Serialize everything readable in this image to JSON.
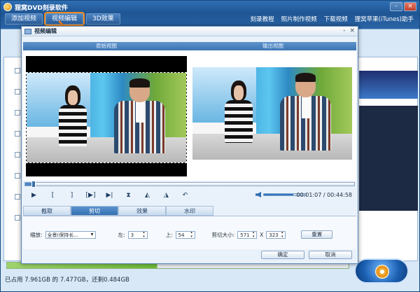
{
  "app": {
    "title": "狸窝DVD刻录软件",
    "window_controls": [
      "-",
      "×"
    ]
  },
  "main_tabs": [
    {
      "label": "添加视频"
    },
    {
      "label": "视频编辑"
    },
    {
      "label": "3D效果"
    }
  ],
  "main_links": [
    "刻录教程",
    "照片制作视频",
    "下载视频",
    "狸窝苹果(iTunes)助手"
  ],
  "status": {
    "disk_info": "已占用 7.961GB 的 7.477GB，还剩0.484GB"
  },
  "dialog": {
    "title": "视频编辑",
    "window_controls": [
      "-",
      "×"
    ],
    "view_headers": {
      "original": "原始视图",
      "output": "输出视图"
    },
    "playback": {
      "controls": [
        "▶",
        "[",
        "]",
        "[▶]",
        "▶|",
        "⧗",
        "◭",
        "◮",
        "↶"
      ],
      "timecode": "00:01:07 / 00:44:58",
      "progress": 0.025,
      "volume": 0.7
    },
    "func_tabs": [
      {
        "label": "截取",
        "active": false
      },
      {
        "label": "剪切",
        "active": true
      },
      {
        "label": "效果",
        "active": false
      },
      {
        "label": "水印",
        "active": false
      }
    ],
    "params": {
      "zoom_label": "缩放:",
      "zoom_value": "全景(保持长...",
      "left_label": "左:",
      "left_value": "3",
      "top_label": "上:",
      "top_value": "54",
      "crop_size_label": "剪切大小:",
      "crop_w": "571",
      "x_sep": "X",
      "crop_h": "323",
      "reset_label": "重置"
    },
    "footer": {
      "ok_label": "确定",
      "cancel_label": "取消"
    }
  },
  "colors": {
    "accent": "#3c74b3",
    "highlight": "#f08a1a",
    "title_bar": "#1f5593"
  }
}
